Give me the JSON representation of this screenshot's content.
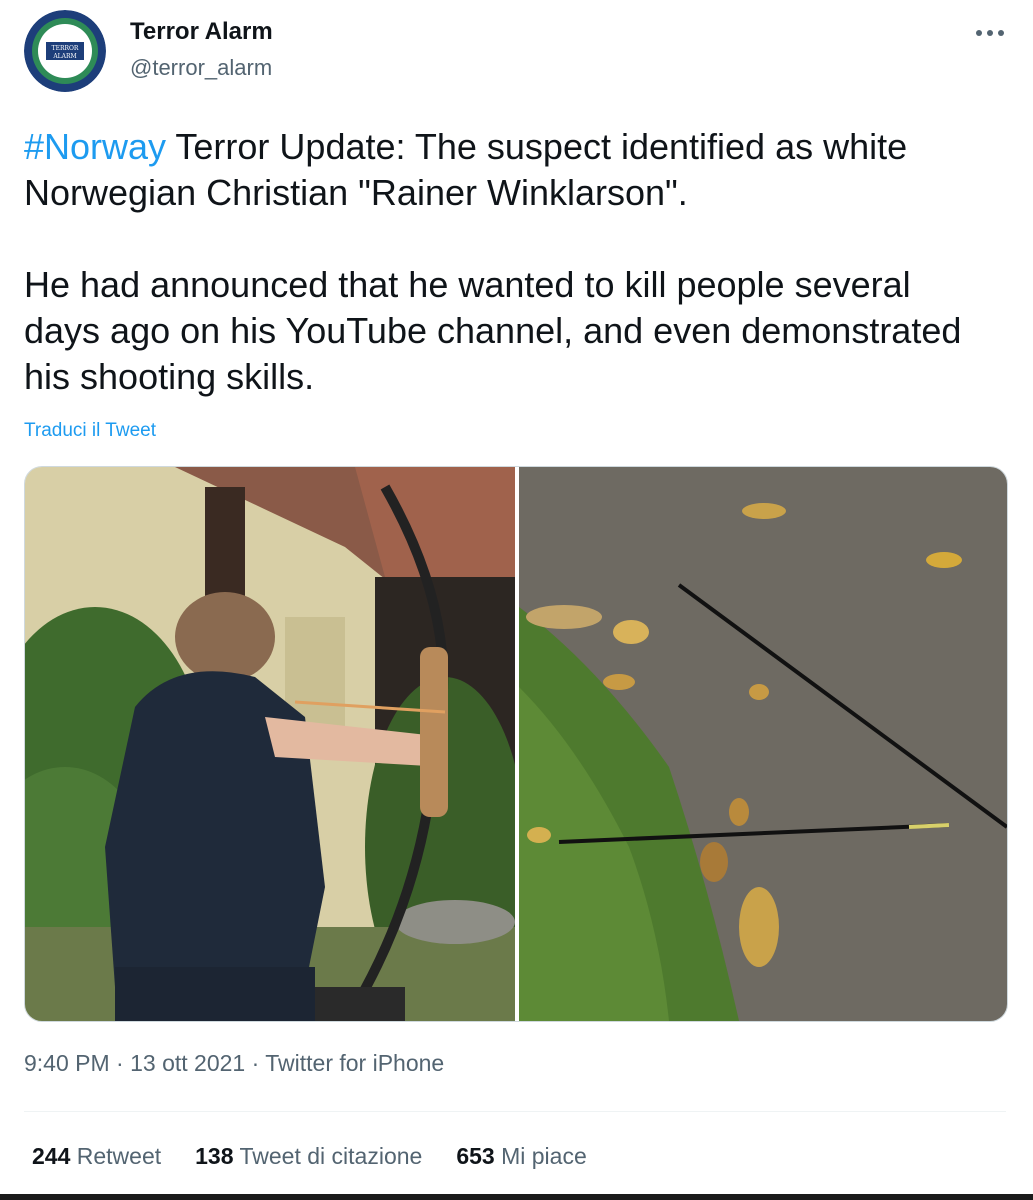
{
  "author": {
    "display_name": "Terror Alarm",
    "handle": "@terror_alarm",
    "avatar_text_top": "TERROR",
    "avatar_text_bottom": "ALARM"
  },
  "tweet": {
    "hashtag": "#Norway",
    "line1_rest": " Terror Update: The suspect identified as white Norwegian Christian \"Rainer Winklarson\".",
    "paragraph2": "He had announced that he wanted to kill people several days ago on his YouTube channel, and even demonstrated his shooting skills.",
    "translate_label": "Traduci il Tweet"
  },
  "meta": {
    "time": "9:40 PM",
    "separator": " · ",
    "date": "13 ott 2021",
    "source": "Twitter for iPhone"
  },
  "stats": {
    "retweets_count": "244",
    "retweets_label": "Retweet",
    "quotes_count": "138",
    "quotes_label": "Tweet di citazione",
    "likes_count": "653",
    "likes_label": "Mi piace"
  },
  "icons": {
    "more": "more-dots-icon"
  },
  "colors": {
    "link": "#1d9bf0",
    "secondary_text": "#536471",
    "primary_text": "#0f1419"
  }
}
